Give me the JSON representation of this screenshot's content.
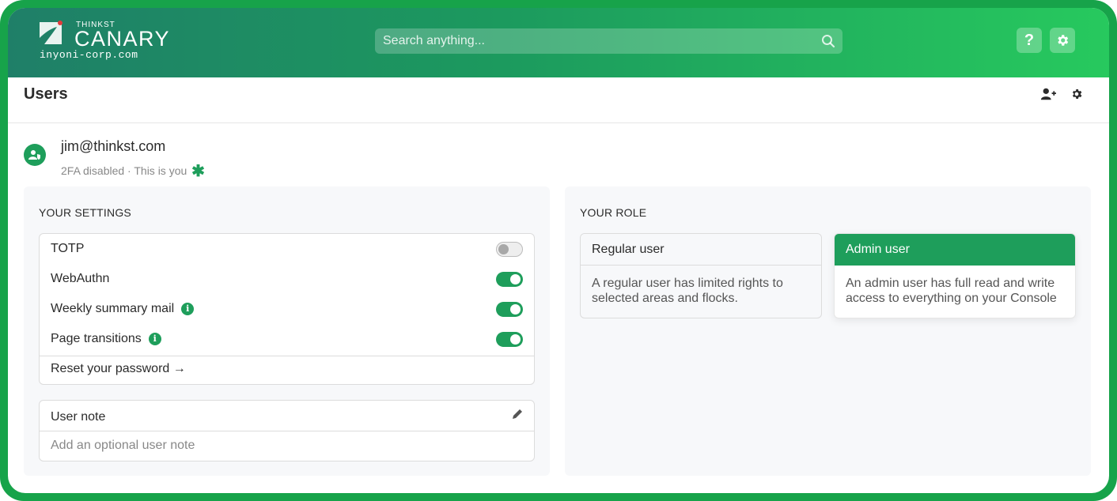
{
  "header": {
    "brand_small": "THINKST",
    "brand_big": "CANARY",
    "domain": "inyoni-corp.com",
    "search_placeholder": "Search anything...",
    "help_glyph": "?",
    "icons": [
      "search-icon",
      "help-icon",
      "gear-icon"
    ]
  },
  "titlebar": {
    "title": "Users",
    "icons": [
      "add-user-icon",
      "gear-icon"
    ]
  },
  "user": {
    "email": "jim@thinkst.com",
    "subtitle": "2FA disabled · This is you",
    "marker": "✱"
  },
  "settings": {
    "title": "YOUR SETTINGS",
    "items": [
      {
        "label": "TOTP",
        "enabled": false,
        "info": false
      },
      {
        "label": "WebAuthn",
        "enabled": true,
        "info": false
      },
      {
        "label": "Weekly summary mail",
        "enabled": true,
        "info": true
      },
      {
        "label": "Page transitions",
        "enabled": true,
        "info": true
      }
    ],
    "reset_link": "Reset your password →",
    "note_title": "User note",
    "note_placeholder": "Add an optional user note"
  },
  "role": {
    "title": "YOUR ROLE",
    "options": [
      {
        "name": "Regular user",
        "description": "A regular user has limited rights to selected areas and flocks.",
        "selected": false
      },
      {
        "name": "Admin user",
        "description": "An admin user has full read and write access to everything on your Console",
        "selected": true
      }
    ]
  },
  "colors": {
    "accent": "#1e9e5b",
    "frame": "#17a34a",
    "header_start": "#1f7f68",
    "header_end": "#27c95e"
  }
}
